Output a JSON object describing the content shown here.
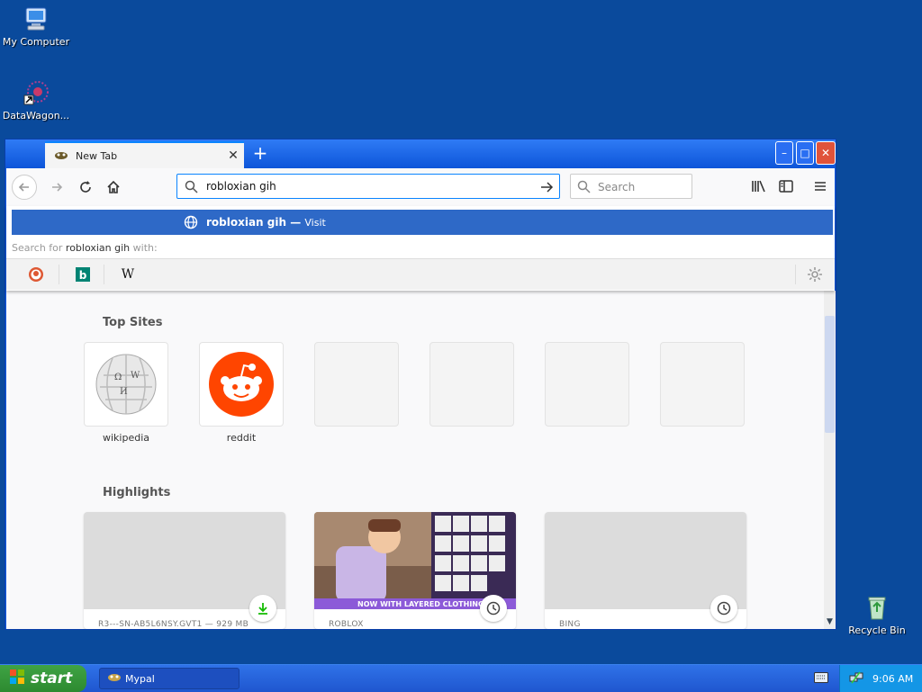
{
  "desktop": {
    "icons": [
      {
        "label": "My Computer",
        "icon": "computer-icon"
      },
      {
        "label": "DataWagon...",
        "icon": "datawagon-icon"
      },
      {
        "label": "Recycle Bin",
        "icon": "recycle-bin-icon"
      }
    ]
  },
  "browser": {
    "tab": {
      "title": "New Tab",
      "close": "✕"
    },
    "new_tab": "+",
    "window_controls": {
      "minimize": "–",
      "maximize": "□",
      "close": "✕"
    },
    "url": {
      "value": "robloxian gih"
    },
    "search": {
      "placeholder": "Search"
    },
    "autocomplete": {
      "query": "robloxian gih",
      "separator": " — ",
      "action": "Visit",
      "search_for_prefix": "Search for ",
      "search_for_suffix": " with:",
      "engines": [
        {
          "name": "DuckDuckGo",
          "icon": "duckduckgo-icon"
        },
        {
          "name": "Bing",
          "icon": "bing-icon",
          "glyph": "b"
        },
        {
          "name": "Wikipedia",
          "icon": "wikipedia-icon",
          "glyph": "W"
        }
      ]
    },
    "top_sites": {
      "title": "Top Sites",
      "sites": [
        {
          "label": "wikipedia"
        },
        {
          "label": "reddit"
        }
      ]
    },
    "highlights": {
      "title": "Highlights",
      "cards": [
        {
          "source": "R3---SN-AB5L6NSY.GVT1 — 929 MB",
          "badge": "download-icon"
        },
        {
          "source": "ROBLOX",
          "badge": "clock-icon",
          "overlay_text": "NOW WITH LAYERED CLOTHING"
        },
        {
          "source": "BING",
          "badge": "clock-icon"
        }
      ]
    }
  },
  "taskbar": {
    "start": "start",
    "task": "Mypal",
    "clock": "9:06 AM"
  },
  "colors": {
    "desktop": "#0a4a9c",
    "accent": "#0a84ff",
    "autocomplete_highlight": "#2e69c7",
    "reddit": "#ff4500"
  }
}
